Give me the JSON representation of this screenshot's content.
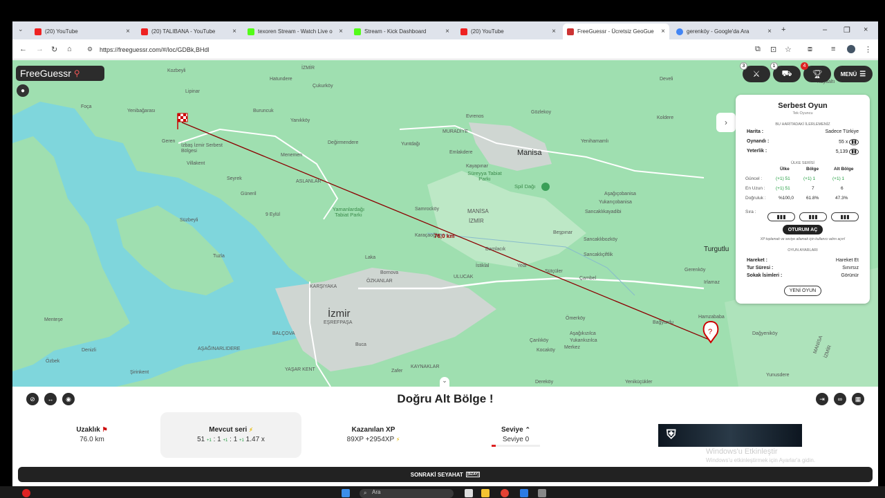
{
  "browser": {
    "tabs": [
      {
        "title": "(20) YouTube",
        "fav": "#e22"
      },
      {
        "title": "(20) TALIBANA - YouTube",
        "fav": "#e22"
      },
      {
        "title": "texoren Stream - Watch Live o",
        "fav": "#53fc18"
      },
      {
        "title": "Stream - Kick Dashboard",
        "fav": "#53fc18"
      },
      {
        "title": "(20) YouTube",
        "fav": "#e22"
      },
      {
        "title": "FreeGuessr - Ücretsiz GeoGue",
        "fav": "#c33"
      },
      {
        "title": "gerenköy - Google'da Ara",
        "fav": "#4285f4"
      }
    ],
    "url": "https://freeguessr.com/#/loc/GDBk,BHdl"
  },
  "logo": "FreeGuessr",
  "top_buttons": {
    "battle_badge": "3",
    "duel_badge": "1",
    "trophy_badge": "4",
    "menu_label": "MENÜ"
  },
  "map": {
    "labels": {
      "kozbeyli": "Kozbeyli",
      "izmir_top": "İZMİR",
      "cukurkoy": "Çukurköy",
      "hatundere": "Hatundere",
      "lipinar": "Lipinar",
      "buruncuk": "Buruncuk",
      "yenibagarasi": "Yenibağarası",
      "foca": "Foça",
      "yanikkoy": "Yanıkköy",
      "muradiye": "MURADİYE",
      "evrenos": "Evrenos",
      "gozlekoy": "Gözlekoy",
      "develi": "Develi",
      "degirmendere": "Değirmendere",
      "geren": "Geren",
      "izbas": "İzbaş İzmir\nSerbest Bölgesi",
      "villakent": "Villakent",
      "menemen": "Menemen",
      "yuntdagi": "Yuntdağı",
      "emlakdere": "Emlakdere",
      "manisa": "Manisa",
      "yenihamamli": "Yenihamamlı",
      "koldere": "Koldere",
      "kayapinar": "Kayapınar",
      "sureyya": "Süreyya\nTabiat Parkı",
      "seyrek": "Seyrek",
      "aslanlar": "ASLANLAR",
      "spildagi": "Spil Dağı",
      "guneril": "Güneril",
      "asagicobanisa": "Aşağıçobanisa",
      "yukaricobanisa": "Yukarıçobanisa",
      "yamanlar": "Yamanlardağı\nTabiat Parkı",
      "samrockoy": "Samrocköy",
      "manisa2": "MANİSA",
      "izmir2": "İZMİR",
      "sancaklikayadibi": "Sancaklıkayadibi",
      "suzbeyli": "Süzbeyli",
      "dokuzeylul": "9 Eylül",
      "karacaoglan": "Karaçaoğlan",
      "bespinar": "Beşpınar",
      "sancaklibozkoy": "Sancaklıbozköy",
      "turgutlu": "Turgutlu",
      "tuzla": "Tuzla",
      "damlacik": "Damlacık",
      "sancakligecek": "Sancaklıçiftlik",
      "laka": "Laka",
      "istiklal": "İstiklal",
      "yedi": "Yedi",
      "sutculer": "Sütçüler",
      "cambel": "Çambel",
      "gerenkoy": "Gerenköy",
      "irlamaz": "Irlamaz",
      "bornova": "Bornova",
      "ulucak": "ULUCAK",
      "ozkanlar": "ÖZKANLAR",
      "karsiyaka": "KARŞIYAKA",
      "izmir_big": "İzmir",
      "esrefpasa": "EŞREFPAŞA",
      "menteshe": "Menteşe",
      "omerkoy": "Ömerköy",
      "hamzababa": "Hamzababa",
      "bagyurdu": "Bağyurdu",
      "dagyenikoy": "Dağyeniköy",
      "asagikizilca": "Aşağıkızılca",
      "yukarikizilca": "Yukarıkızılca",
      "canlikoy": "Çanlıköy",
      "kocakoy": "Kocaköy",
      "merkez": "Merkez",
      "balcova": "BALÇOVA",
      "buca": "Buca",
      "denizli_ok": "Denizli",
      "asaginarlidere": "AŞAĞINARLIDERE",
      "ozbek": "Özbek",
      "sirinkent": "Şirinkent",
      "yasarkent": "YAŞAR KENT",
      "kaynaklar": "KAYNAKLAR",
      "zafer": "Zafer",
      "yenikulerkoy": "Yeniküçükler",
      "yunusdere": "Yunusdere",
      "dereköy": "Dereköy",
      "manisa3": "MANİSA",
      "izmir3": "İZMİR",
      "kayaalti": "Kayaaltı"
    },
    "distance_label": "76,0 km"
  },
  "panel": {
    "title": "Serbest Oyun",
    "subtitle": "Tek Oyuncu",
    "progress_header": "BU HARİTADAKİ İLERLEMENİZ",
    "map_label": "Harita :",
    "map_value": "Sadece Türkiye",
    "played_label": "Oynandı :",
    "played_value": "55 x",
    "competence_label": "Yeterlik :",
    "competence_value": "5,139",
    "country_series_header": "ÜLKE SERİSİ",
    "col_country": "Ülke",
    "col_region": "Bölge",
    "col_subregion": "Alt Bölge",
    "current_label": "Güncel :",
    "current_country": "(+1) 51",
    "current_region": "(+1) 1",
    "current_subregion": "(+1) 1",
    "longest_label": "En Uzun :",
    "longest_country": "(+1) 51",
    "longest_region": "7",
    "longest_subregion": "6",
    "accuracy_label": "Doğruluk :",
    "accuracy_country": "%100,0",
    "accuracy_region": "61.8%",
    "accuracy_subregion": "47.3%",
    "rank_label": "Sıra :",
    "session_button": "OTURUM AÇ",
    "session_note": "XP toplamak ve seviye atlamak için kullanıcı adını açın!",
    "settings_header": "OYUN AYARLARI",
    "movement_label": "Hareket :",
    "movement_value": "Hareket Et",
    "round_time_label": "Tur Süresi :",
    "round_time_value": "Sınırsız",
    "street_names_label": "Sokak İsimleri :",
    "street_names_value": "Görünür",
    "new_game_button": "YENİ OYUN"
  },
  "result": {
    "title": "Doğru Alt Bölge !",
    "distance_label": "Uzaklık",
    "distance_value": "76.0 km",
    "streak_label": "Mevcut seri",
    "streak_value_1": "51",
    "streak_value_2": "1",
    "streak_value_3": "1",
    "streak_mult": "1.47 x",
    "xp_label": "Kazanılan XP",
    "xp_value": "89XP  +2954XP",
    "level_label": "Seviye",
    "level_value": "Seviye 0",
    "next_button": "SONRAKİ SEYAHAT",
    "next_hint": "[BZAY]"
  },
  "watermark": {
    "title": "Windows'u Etkinleştir",
    "subtitle": "Windows'u etkinleştirmek için Ayarlar'a gidin."
  },
  "taskbar": {
    "search_placeholder": "Ara"
  },
  "colors": {
    "accent": "#222222",
    "line": "#8b0000",
    "water": "#7fd6dc",
    "land": "#9fdfb0"
  }
}
